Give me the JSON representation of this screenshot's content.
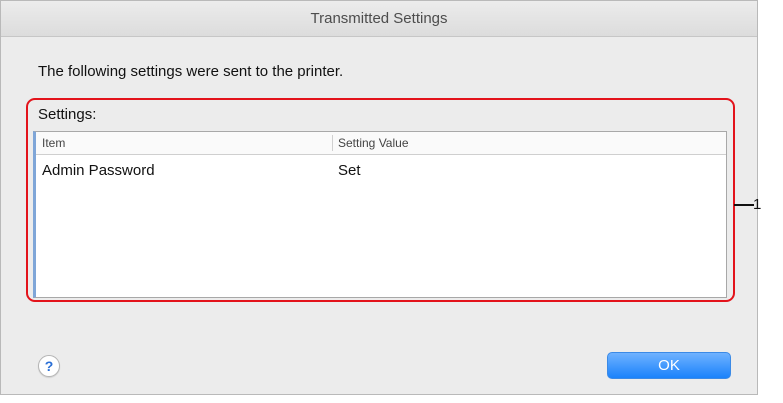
{
  "window": {
    "title": "Transmitted Settings"
  },
  "message": "The following settings were sent to the printer.",
  "settings": {
    "label": "Settings:",
    "columns": [
      "Item",
      "Setting Value"
    ],
    "rows": [
      {
        "item": "Admin Password",
        "value": "Set"
      }
    ]
  },
  "callout": {
    "number": "1",
    "color": "#e3131b"
  },
  "help": {
    "label": "?",
    "icon": "help-icon"
  },
  "ok_button": {
    "label": "OK",
    "color": "#1a82fb"
  }
}
